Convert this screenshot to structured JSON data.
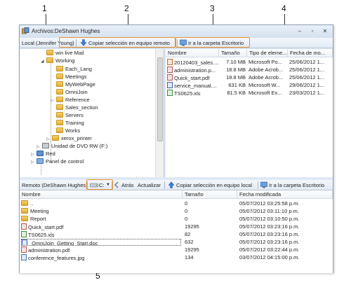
{
  "callouts": [
    "1",
    "2",
    "3",
    "4",
    "5"
  ],
  "window": {
    "title": "Archivos:DeShawn Hughes",
    "buttons": [
      "–",
      "▫",
      "✕"
    ]
  },
  "local_toolbar": {
    "location": "Local (Jennifer Young)",
    "copy_remote": "Copiar selección en equipo remoto",
    "goto_desktop": "Ir a la carpeta Escritorio"
  },
  "tree": {
    "items": [
      {
        "label": "win live Mail"
      },
      {
        "label": "Working"
      },
      {
        "label": "Each_Lang"
      },
      {
        "label": "Meetings"
      },
      {
        "label": "MyWebPage"
      },
      {
        "label": "OmniJoin"
      },
      {
        "label": "Reference"
      },
      {
        "label": "Sales_section"
      },
      {
        "label": "Servers"
      },
      {
        "label": "Training"
      },
      {
        "label": "Works"
      },
      {
        "label": "xerox_printer"
      },
      {
        "label": "Unidad de DVD RW (F:)"
      },
      {
        "label": "Red"
      },
      {
        "label": "Panel de control"
      }
    ]
  },
  "top_table": {
    "headers": [
      "Nombre",
      "Tamaño",
      "Tipo de eleme...",
      "Fecha de mo..."
    ],
    "rows": [
      {
        "name": "20120403_sales....",
        "size": "7.10 MB",
        "type": "Microsoft Po...",
        "date": "25/06/2012 1..."
      },
      {
        "name": "administration.p...",
        "size": "18.8 MB",
        "type": "Adobe Acrob...",
        "date": "25/06/2012 1..."
      },
      {
        "name": "Quick_start.pdf",
        "size": "18.8 MB",
        "type": "Adobe Acrob...",
        "date": "25/06/2012 1..."
      },
      {
        "name": "service_manual....",
        "size": "631 KB",
        "type": "Microsoft W...",
        "date": "29/06/2012 1..."
      },
      {
        "name": "TS0625.xls",
        "size": "81.5 KB",
        "type": "Microsoft Ex...",
        "date": "23/03/2012 1..."
      }
    ]
  },
  "remote_toolbar": {
    "location": "Remoto (DeShawn Hughes)",
    "drive": "C:",
    "back": "Atrás",
    "refresh": "Actualizar",
    "copy_local": "Copiar selección en equipo local",
    "goto_desktop": "Ir a la carpeta Escritorio"
  },
  "bottom_table": {
    "headers": [
      "Nombre",
      "Tamaño",
      "Fecha modificada"
    ],
    "rows": [
      {
        "name": "..",
        "size": "0",
        "date": "05/07/2012 03:25:58 p.m."
      },
      {
        "name": "Meeting",
        "size": "0",
        "date": "05/07/2012 03:11:10 p.m."
      },
      {
        "name": "Report",
        "size": "0",
        "date": "05/07/2012 03:10:50 p.m."
      },
      {
        "name": "Quick_start.pdf",
        "size": "19295",
        "date": "05/07/2012 03:23:16 p.m."
      },
      {
        "name": "TS0625.xls",
        "size": "82",
        "date": "05/07/2012 03:23:16 p.m."
      },
      {
        "name": "_OmniJoin_Getting_Start.doc",
        "size": "632",
        "date": "05/07/2012 03:23:16 p.m."
      },
      {
        "name": "administration.pdf",
        "size": "19295",
        "date": "05/07/2012 03:22:44 p.m."
      },
      {
        "name": "conference_features.jpg",
        "size": "134",
        "date": "03/07/2012 04:15:00 p.m."
      }
    ]
  },
  "colors": {
    "callout_highlight": "#e8922a",
    "window_bg": "#dfe9f5",
    "folder": "#e2ab2e"
  }
}
